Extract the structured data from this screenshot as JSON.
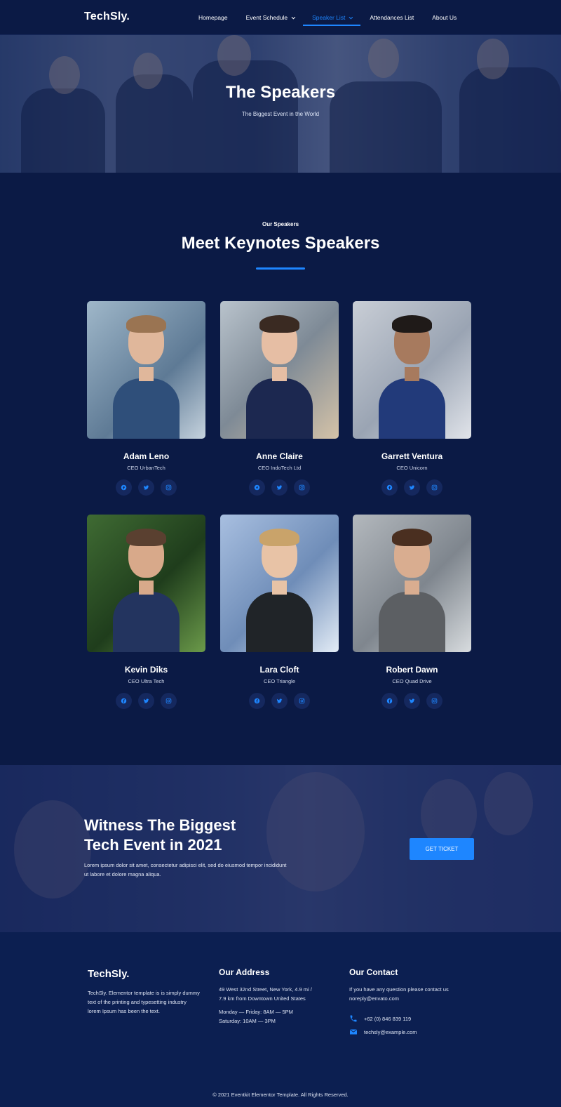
{
  "brand": {
    "name": "TechSly.",
    "accent": "#1e86ff",
    "background": "#0b1a45"
  },
  "nav": {
    "items": [
      {
        "label": "Homepage",
        "dropdown": false,
        "active": false
      },
      {
        "label": "Event Schedule",
        "dropdown": true,
        "active": false
      },
      {
        "label": "Speaker List",
        "dropdown": true,
        "active": true
      },
      {
        "label": "Attendances List",
        "dropdown": false,
        "active": false
      },
      {
        "label": "About Us",
        "dropdown": false,
        "active": false
      }
    ]
  },
  "hero": {
    "title": "The Speakers",
    "subtitle": "The Biggest Event in the World"
  },
  "speakers_section": {
    "eyebrow": "Our Speakers",
    "title": "Meet Keynotes Speakers",
    "social_icons": [
      "facebook-icon",
      "twitter-icon",
      "instagram-icon"
    ],
    "speakers": [
      {
        "name": "Adam Leno",
        "role": "CEO UrbanTech"
      },
      {
        "name": "Anne Claire",
        "role": "CEO IndoTech Ltd"
      },
      {
        "name": "Garrett Ventura",
        "role": "CEO Unicorn"
      },
      {
        "name": "Kevin Diks",
        "role": "CEO Ultra Tech"
      },
      {
        "name": "Lara Cloft",
        "role": "CEO Triangle"
      },
      {
        "name": "Robert Dawn",
        "role": "CEO Quad Drive"
      }
    ]
  },
  "cta": {
    "title_line1": "Witness The Biggest",
    "title_line2": "Tech Event in 2021",
    "text": "Lorem ipsum dolor sit amet, consectetur adipisci elit, sed do eiusmod tempor incididunt ut labore et dolore magna aliqua.",
    "button": "GET TICKET"
  },
  "footer": {
    "about": {
      "logo": "TechSly.",
      "text": "TechSly. Elementor template is is simply dummy text of the printing and typesetting industry lorem Ipsum has been the text."
    },
    "address": {
      "heading": "Our Address",
      "line": "49 West 32nd Street, New York, 4.9 mi / 7.9 km from Downtown United States",
      "hours1": "Monday — Friday: 8AM — 5PM",
      "hours2": "Saturday: 10AM — 3PM"
    },
    "contact": {
      "heading": "Our Contact",
      "text": "If you have any question please contact us noreply@envato.com",
      "phone": "+62 (0) 846 839 119",
      "email": "techsly@example.com"
    },
    "copyright": "© 2021 Eventkit Elementor Template. All Rights Reserved."
  }
}
